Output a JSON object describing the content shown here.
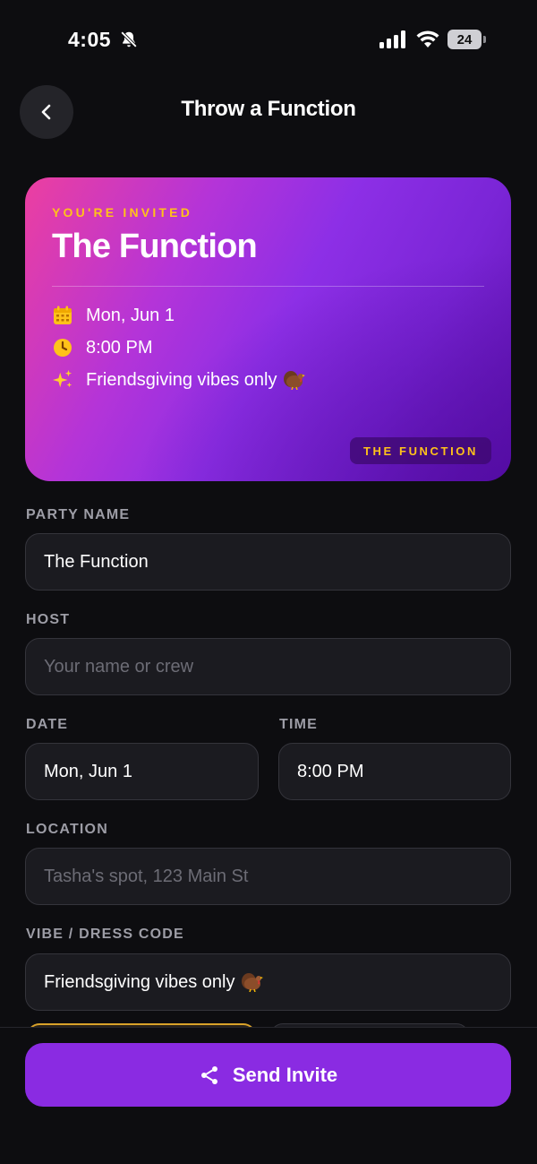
{
  "status_bar": {
    "time": "4:05",
    "battery": "24",
    "icons": [
      "bell-slash-icon",
      "signal-icon",
      "wifi-icon",
      "battery-icon"
    ]
  },
  "header": {
    "title": "Throw a Function",
    "back_icon": "chevron-left-icon"
  },
  "card": {
    "eyebrow": "YOU'RE INVITED",
    "title": "The Function",
    "date": "Mon, Jun 1",
    "time": "8:00 PM",
    "vibe": "Friendsgiving vibes only",
    "badge": "THE FUNCTION",
    "icons": [
      "calendar-icon",
      "clock-icon",
      "sparkles-icon",
      "turkey-emoji-icon"
    ],
    "colors": {
      "gradient_start": "#ec3fa0",
      "gradient_mid": "#8d2fe6",
      "gradient_end": "#5e12ad",
      "accent": "#ffc21a"
    }
  },
  "form": {
    "party_name": {
      "label": "PARTY NAME",
      "value": "The Function"
    },
    "host": {
      "label": "HOST",
      "placeholder": "Your name or crew"
    },
    "date": {
      "label": "DATE",
      "value": "Mon, Jun 1"
    },
    "time": {
      "label": "TIME",
      "value": "8:00 PM"
    },
    "location": {
      "label": "LOCATION",
      "placeholder": "Tasha's spot, 123 Main St"
    },
    "vibe": {
      "label": "VIBE / DRESS CODE",
      "value": "Friendsgiving vibes only"
    }
  },
  "send_button": {
    "label": "Send Invite",
    "icon": "share-icon",
    "color": "#8a2be2"
  }
}
